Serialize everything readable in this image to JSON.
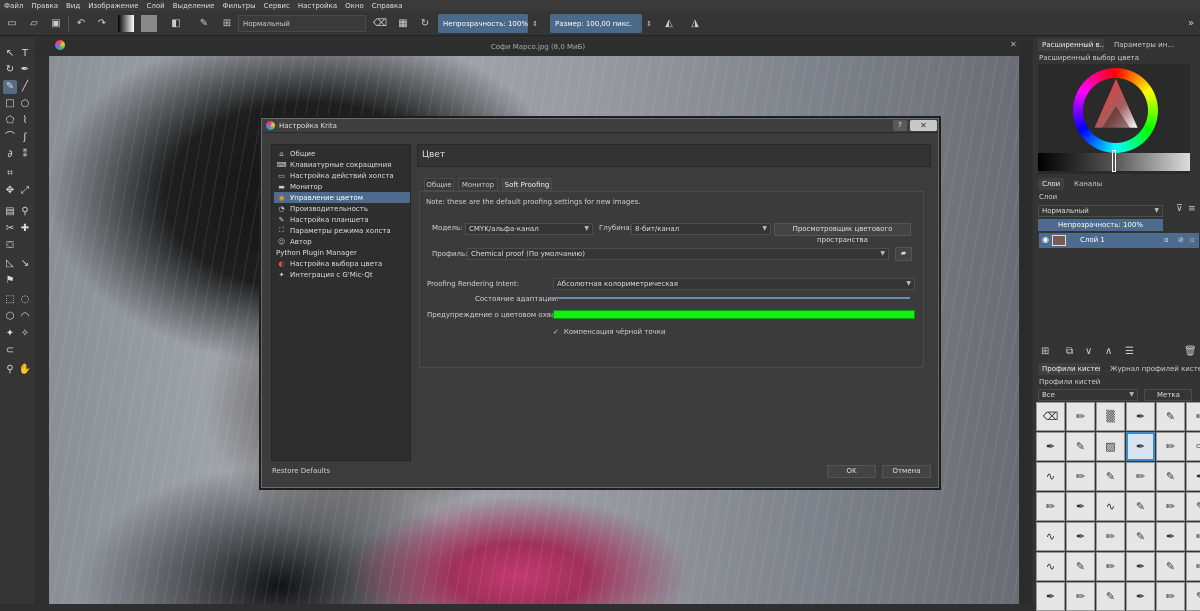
{
  "menu": [
    "Файл",
    "Правка",
    "Вид",
    "Изображение",
    "Слой",
    "Выделение",
    "Фильтры",
    "Сервис",
    "Настройка",
    "Окно",
    "Справка"
  ],
  "toolbar": {
    "blend_mode": "Нормальный",
    "opacity": "Непрозрачность: 100%",
    "size": "Размер: 100,00 пикс."
  },
  "canvas": {
    "title": "Софи Марсо.jpg (8,0 МиБ)"
  },
  "dialog": {
    "title": "Настройка Krita",
    "help_label": "?",
    "close_label": "✕",
    "nav": [
      {
        "label": "Общие",
        "icon": "home-icon"
      },
      {
        "label": "Клавиатурные сокращения",
        "icon": "keyboard-icon"
      },
      {
        "label": "Настройка действий холста",
        "icon": "canvas-actions-icon"
      },
      {
        "label": "Монитор",
        "icon": "monitor-icon"
      },
      {
        "label": "Управление цветом",
        "icon": "color-management-icon"
      },
      {
        "label": "Производительность",
        "icon": "performance-icon"
      },
      {
        "label": "Настройка планшета",
        "icon": "tablet-icon"
      },
      {
        "label": "Параметры режима холста",
        "icon": "canvas-mode-icon"
      },
      {
        "label": "Автор",
        "icon": "author-icon"
      },
      {
        "label": "Python Plugin Manager",
        "icon": ""
      },
      {
        "label": "Настройка выбора цвета",
        "icon": "color-selector-icon"
      },
      {
        "label": "Интеграция с G'Mic-Qt",
        "icon": "gmic-icon"
      }
    ],
    "selected_nav": "Управление цветом",
    "page_title": "Цвет",
    "tabs": [
      "Общие",
      "Монитор",
      "Soft Proofing"
    ],
    "active_tab": "Soft Proofing",
    "note": "Note: these are the default proofing settings for new images.",
    "model_label": "Модель:",
    "model_value": "CMYK/альфа-канал",
    "depth_label": "Глубина:",
    "depth_value": "8-бит/канал",
    "color_space_browser": "Просмотровщик цветового пространства",
    "profile_label": "Профиль:",
    "profile_value": "Chemical proof (По умолчанию)",
    "intent_label": "Proofing Rendering Intent:",
    "intent_value": "Абсолютная колориметрическая",
    "adaptation_label": "Состояние адаптации:",
    "gamut_warning_label": "Предупреждение о цветовом охвате:",
    "black_point_label": "Компенсация чёрной точки",
    "black_point_checked": true,
    "restore_label": "Restore Defaults",
    "ok_label": "OK",
    "cancel_label": "Отмена",
    "gamut_color": "#14f014",
    "accent_color": "#4d6b8e"
  },
  "dock": {
    "tab_advanced": "Расширенный в...",
    "tab_tool_options": "Параметры ин...",
    "selector_title": "Расширенный выбор цвета",
    "tab_layers": "Слои",
    "tab_channels": "Каналы",
    "layers_title": "Слои",
    "layer_blend": "Нормальный",
    "layer_opacity": "Непрозрачность: 100%",
    "layer_name": "Слой 1",
    "tab_brush_presets": "Профили кистей",
    "tab_brush_history": "Журнал профилей кистей",
    "presets_title": "Профили кистей",
    "filter_all": "Все",
    "tag_label": "Метка"
  }
}
